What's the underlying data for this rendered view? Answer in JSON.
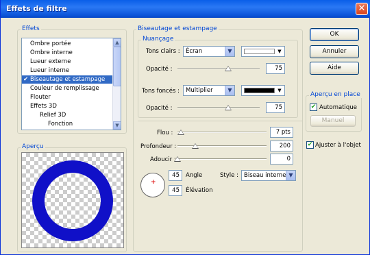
{
  "window": {
    "title": "Effets de filtre",
    "close": "✕"
  },
  "effects": {
    "label": "Effets",
    "items": [
      {
        "label": "Ombre portée",
        "checked": ""
      },
      {
        "label": "Ombre interne",
        "checked": ""
      },
      {
        "label": "Lueur externe",
        "checked": ""
      },
      {
        "label": "Lueur interne",
        "checked": ""
      },
      {
        "label": "Biseautage et estampage",
        "checked": "✔"
      },
      {
        "label": "Couleur de remplissage",
        "checked": ""
      },
      {
        "label": "Flouter",
        "checked": ""
      },
      {
        "label": "Effets 3D",
        "checked": ""
      },
      {
        "label": "Relief 3D",
        "checked": ""
      },
      {
        "label": "Fonction",
        "checked": ""
      }
    ]
  },
  "preview": {
    "label": "Aperçu",
    "ring_color": "#1010c8"
  },
  "bevel": {
    "label": "Biseautage et estampage",
    "shading_label": "Nuançage",
    "highlights_label": "Tons clairs :",
    "highlights_mode": "Écran",
    "highlights_color": "#ffffff",
    "opacity_label": "Opacité :",
    "highlights_opacity": "75",
    "highlights_opacity_pct": 62,
    "shadows_label": "Tons foncés :",
    "shadows_mode": "Multiplier",
    "shadows_color": "#000000",
    "shadows_opacity": "75",
    "shadows_opacity_pct": 62,
    "blur_label": "Flou :",
    "blur_value": "7 pts",
    "blur_pct": 4,
    "depth_label": "Profondeur :",
    "depth_value": "200",
    "depth_pct": 20,
    "soften_label": "Adoucir :",
    "soften_value": "0",
    "soften_pct": 0,
    "angle_value": "45",
    "angle_label": "Angle",
    "elevation_value": "45",
    "elevation_label": "Élévation",
    "style_label": "Style :",
    "style_value": "Biseau interne"
  },
  "buttons": {
    "ok": "OK",
    "cancel": "Annuler",
    "help": "Aide"
  },
  "live_preview": {
    "label": "Aperçu en place",
    "auto_label": "Automatique",
    "auto_checked": "✔",
    "manual_label": "Manuel"
  },
  "fit_object": {
    "label": "Ajuster à l'objet",
    "checked": "✔"
  }
}
